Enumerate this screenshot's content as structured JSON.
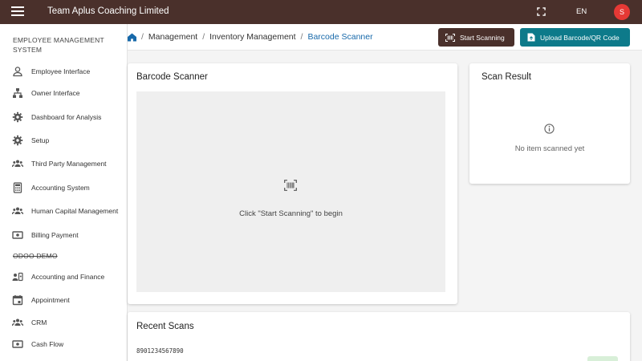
{
  "topbar": {
    "menu_icon": "menu-icon",
    "title": "Team Aplus Coaching Limited",
    "fullscreen_icon": "fullscreen-icon",
    "language": "EN",
    "avatar_initial": "S",
    "colors": {
      "bar": "#4a302b",
      "avatar": "#e53935"
    }
  },
  "sidebar": {
    "section1": "EMPLOYEE MANAGEMENT SYSTEM",
    "items": [
      {
        "label": "Employee Interface",
        "icon": "person-icon"
      },
      {
        "label": "Owner Interface",
        "icon": "hierarchy-icon"
      },
      {
        "label": "Dashboard for Analysis",
        "icon": "gear-icon"
      },
      {
        "label": "Setup",
        "icon": "gear-icon"
      },
      {
        "label": "Third Party Management",
        "icon": "group-icon"
      },
      {
        "label": "Accounting System",
        "icon": "calculator-icon"
      },
      {
        "label": "Human Capital Management",
        "icon": "group-icon"
      },
      {
        "label": "Billing Payment",
        "icon": "cash-icon"
      }
    ],
    "section2": "ODOO DEMO",
    "items2": [
      {
        "label": "Accounting and Finance",
        "icon": "contact-card-icon"
      },
      {
        "label": "Appointment",
        "icon": "calendar-icon"
      },
      {
        "label": "CRM",
        "icon": "group-icon"
      },
      {
        "label": "Cash Flow",
        "icon": "cash-icon"
      }
    ]
  },
  "breadcrumb": {
    "home_icon": "home-icon",
    "items": [
      "Management",
      "Inventory Management",
      "Barcode Scanner"
    ]
  },
  "actions": {
    "start_label": "Start Scanning",
    "upload_label": "Upload Barcode/QR Code",
    "colors": {
      "start": "#4a302b",
      "upload": "#0d7a8a"
    }
  },
  "scanner": {
    "title": "Barcode Scanner",
    "hint": "Click \"Start Scanning\" to begin",
    "icon": "barcode-scan-icon"
  },
  "result": {
    "title": "Scan Result",
    "empty": "No item scanned yet",
    "icon": "info-icon"
  },
  "recent": {
    "title": "Recent Scans",
    "items": [
      {
        "code": "8901234567890"
      }
    ]
  }
}
